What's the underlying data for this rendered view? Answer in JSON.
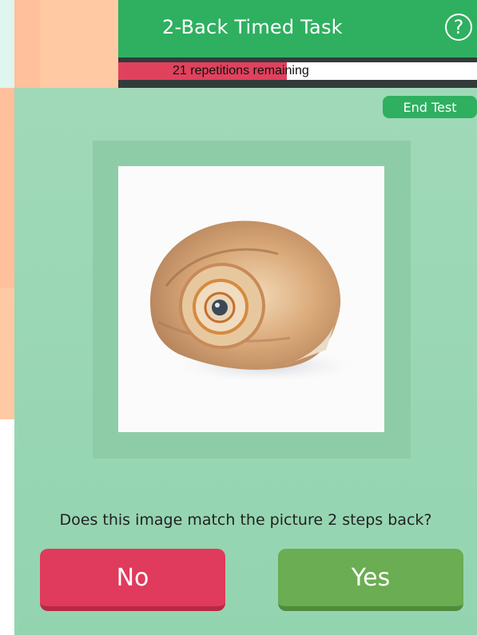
{
  "header": {
    "title": "2-Back Timed Task"
  },
  "progress": {
    "text": "21 repetitions remaining",
    "fraction": 0.47
  },
  "actions": {
    "end_test_label": "End Test"
  },
  "question": {
    "text": "Does this image match the picture 2 steps back?"
  },
  "buttons": {
    "no_label": "No",
    "yes_label": "Yes"
  },
  "icons": {
    "help": "help-circle-icon",
    "stimulus": "snail-shell-image"
  },
  "colors": {
    "header": "#2eb060",
    "progress_fill": "#e0425e",
    "no_button": "#e03a5c",
    "yes_button": "#6aad52",
    "background": "#a0d9b8"
  }
}
